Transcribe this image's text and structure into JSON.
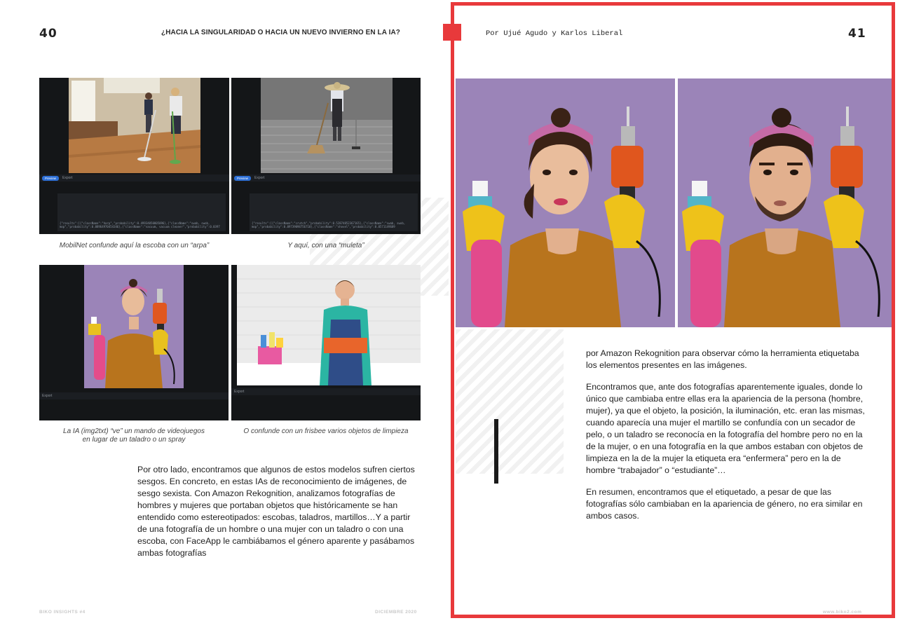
{
  "left_page": {
    "page_number": "40",
    "running_head": "¿HACIA LA SINGULARIDAD O HACIA UN NUEVO INVIERNO EN LA IA?",
    "figures": [
      {
        "caption": "MobilNet confunde aquí la escoba con un “arpa”",
        "toolbar": {
          "button": "Preview",
          "label": "Export"
        },
        "code_lines": [
          "{\"results\":[{\"className\":\"harp\",\"probability\":0.49934050805096},{\"className\":\"swab, swob,",
          "mop\",\"probability\":0.08964970454346},{\"className\":\"vacuum, vacuum cleaner\",\"probability\":0.0397"
        ]
      },
      {
        "caption": "Y aquí, con una “muleta”",
        "toolbar": {
          "button": "Preview",
          "label": "Export"
        },
        "code_lines": [
          "{\"results\":[{\"className\":\"crutch\",\"probability\":0.52874852367165},{\"className\":\"swab, swob,",
          "mop\",\"probability\":0.09739098756710},{\"className\":\"shovel\",\"probability\":0.0571149689"
        ]
      },
      {
        "caption_lines": [
          "La IA (img2txt) “ve” un mando de videojuegos",
          "en lugar de un taladro o un spray"
        ],
        "toolbar": {
          "label": "Export"
        }
      },
      {
        "caption": "O confunde con un frisbee varios objetos de limpieza",
        "toolbar": {
          "label": "Export"
        }
      }
    ],
    "body_paragraphs": [
      "Por otro lado, encontramos que algunos de estos modelos sufren ciertos sesgos. En concreto, en estas IAs de reconocimiento de imágenes, de sesgo sexista. Con Amazon Rekognition, analizamos fotografías de hombres y mujeres que portaban objetos que históricamente se han entendido como estereotipados: escobas, taladros, martillos…Y a partir de una fotografía de un hombre o una mujer con un taladro o con una escoba, con FaceApp le cambiábamos el género aparente y pasábamos ambas fotografías"
    ],
    "footer_left": "BIKO INSIGHTS #4",
    "footer_right": "DICIEMBRE 2020"
  },
  "right_page": {
    "page_number": "41",
    "byline": "Por Ujué Agudo y Karlos Liberal",
    "body_paragraphs": [
      "por Amazon Rekognition para observar cómo la herramienta etiquetaba los elementos presentes en las imágenes.",
      "Encontramos que, ante dos fotografías aparentemente iguales, donde lo único que cambiaba entre ellas era la apariencia de la persona (hombre, mujer), ya que el objeto, la posición, la iluminación, etc. eran las mismas, cuando aparecía una mujer el martillo se confundía con un secador de pelo, o un taladro se reconocía en la fotografía del hombre pero no en la de la mujer, o en una fotografía en la que ambos estaban con objetos de limpieza en la de la mujer la etiqueta era “enfermera” pero en la de hombre “trabajador” o “estudiante”…",
      "En resumen, encontramos que el etiquetado, a pesar de que las fotografías sólo cambiaban en la apariencia de género, no era similar en ambos casos."
    ],
    "footer": "www.biko2.com"
  },
  "colors": {
    "accent_red": "#e8393b",
    "photo_purple": "#9b84b8",
    "shirt_mustard": "#b8741d"
  }
}
